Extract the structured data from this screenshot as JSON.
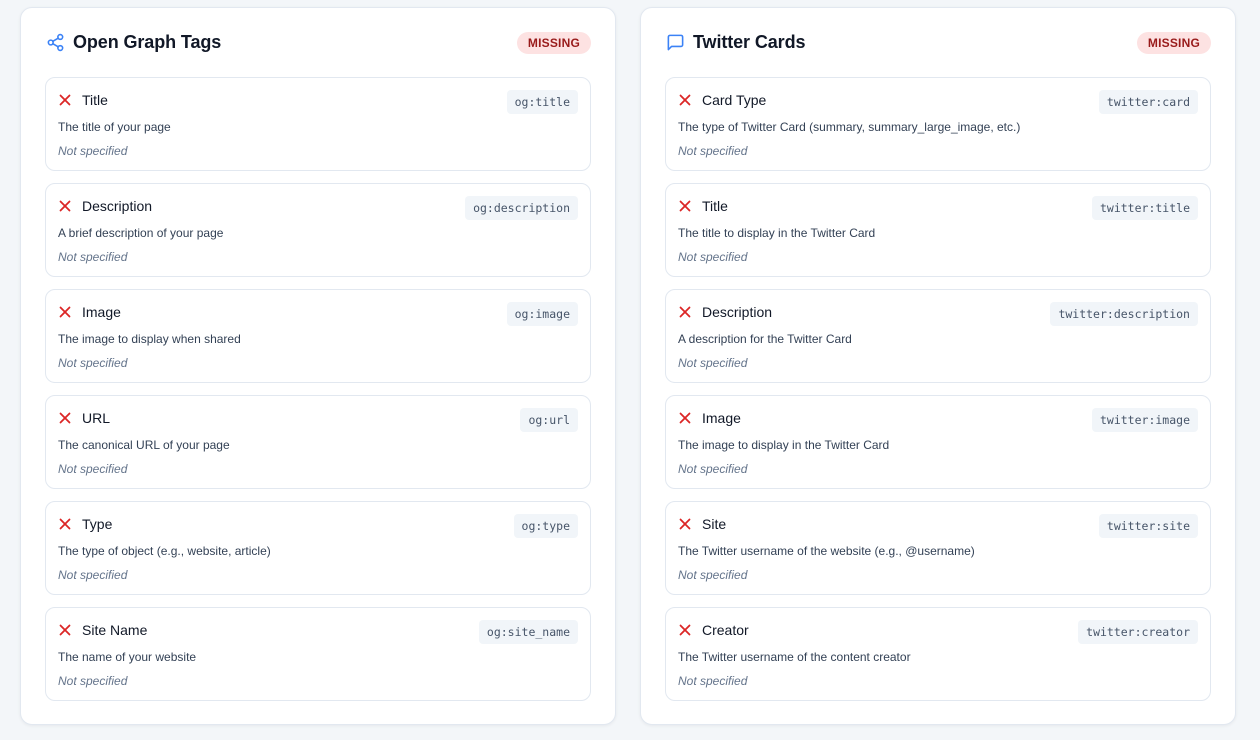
{
  "colors": {
    "accent": "#3b82f6",
    "error": "#dc2626",
    "badge_bg": "#fde2e2",
    "badge_text": "#991b1b"
  },
  "og": {
    "title": "Open Graph Tags",
    "icon": "share-icon",
    "badge": "MISSING",
    "items": [
      {
        "name": "Title",
        "tag": "og:title",
        "desc": "The title of your page",
        "value": "Not specified",
        "status_icon": "x-icon"
      },
      {
        "name": "Description",
        "tag": "og:description",
        "desc": "A brief description of your page",
        "value": "Not specified",
        "status_icon": "x-icon"
      },
      {
        "name": "Image",
        "tag": "og:image",
        "desc": "The image to display when shared",
        "value": "Not specified",
        "status_icon": "x-icon"
      },
      {
        "name": "URL",
        "tag": "og:url",
        "desc": "The canonical URL of your page",
        "value": "Not specified",
        "status_icon": "x-icon"
      },
      {
        "name": "Type",
        "tag": "og:type",
        "desc": "The type of object (e.g., website, article)",
        "value": "Not specified",
        "status_icon": "x-icon"
      },
      {
        "name": "Site Name",
        "tag": "og:site_name",
        "desc": "The name of your website",
        "value": "Not specified",
        "status_icon": "x-icon"
      }
    ]
  },
  "twitter": {
    "title": "Twitter Cards",
    "icon": "message-square-icon",
    "badge": "MISSING",
    "items": [
      {
        "name": "Card Type",
        "tag": "twitter:card",
        "desc": "The type of Twitter Card (summary, summary_large_image, etc.)",
        "value": "Not specified",
        "status_icon": "x-icon"
      },
      {
        "name": "Title",
        "tag": "twitter:title",
        "desc": "The title to display in the Twitter Card",
        "value": "Not specified",
        "status_icon": "x-icon"
      },
      {
        "name": "Description",
        "tag": "twitter:description",
        "desc": "A description for the Twitter Card",
        "value": "Not specified",
        "status_icon": "x-icon"
      },
      {
        "name": "Image",
        "tag": "twitter:image",
        "desc": "The image to display in the Twitter Card",
        "value": "Not specified",
        "status_icon": "x-icon"
      },
      {
        "name": "Site",
        "tag": "twitter:site",
        "desc": "The Twitter username of the website (e.g., @username)",
        "value": "Not specified",
        "status_icon": "x-icon"
      },
      {
        "name": "Creator",
        "tag": "twitter:creator",
        "desc": "The Twitter username of the content creator",
        "value": "Not specified",
        "status_icon": "x-icon"
      }
    ]
  }
}
